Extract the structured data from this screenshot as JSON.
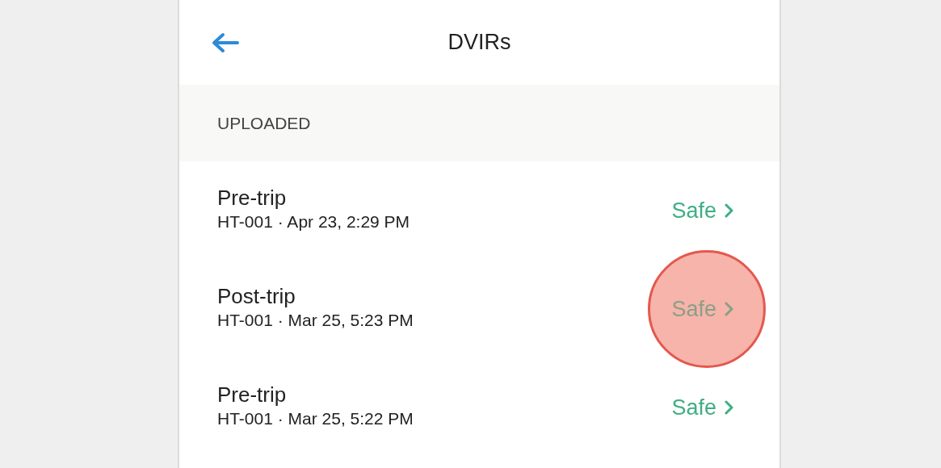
{
  "header": {
    "title": "DVIRs"
  },
  "section": {
    "title": "UPLOADED"
  },
  "reports": [
    {
      "type": "Pre-trip",
      "details": "HT-001 · Apr 23, 2:29 PM",
      "status": "Safe",
      "tapped": false
    },
    {
      "type": "Post-trip",
      "details": "HT-001 · Mar 25, 5:23 PM",
      "status": "Safe",
      "tapped": true
    },
    {
      "type": "Pre-trip",
      "details": "HT-001 · Mar 25, 5:22 PM",
      "status": "Safe",
      "tapped": false
    }
  ]
}
